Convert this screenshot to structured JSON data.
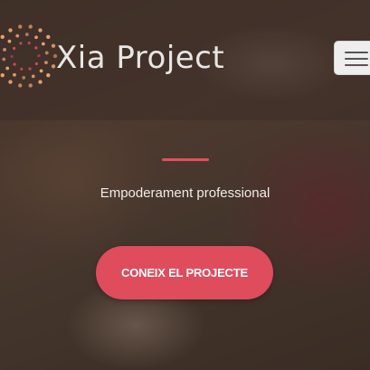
{
  "navbar": {
    "brand": "Xia Project",
    "logo_icon": "dotted-circle-logo-icon",
    "menu_icon": "hamburger-menu-icon"
  },
  "hero": {
    "tagline": "Empoderament professional",
    "cta_label": "CONEIX EL PROJECTE"
  },
  "colors": {
    "accent": "#df4c5c",
    "divider": "#e0515f",
    "logo_dot_outer": "#e9a272",
    "logo_dot_inner": "#d24c5c",
    "brand_text": "#e8e6e4"
  }
}
